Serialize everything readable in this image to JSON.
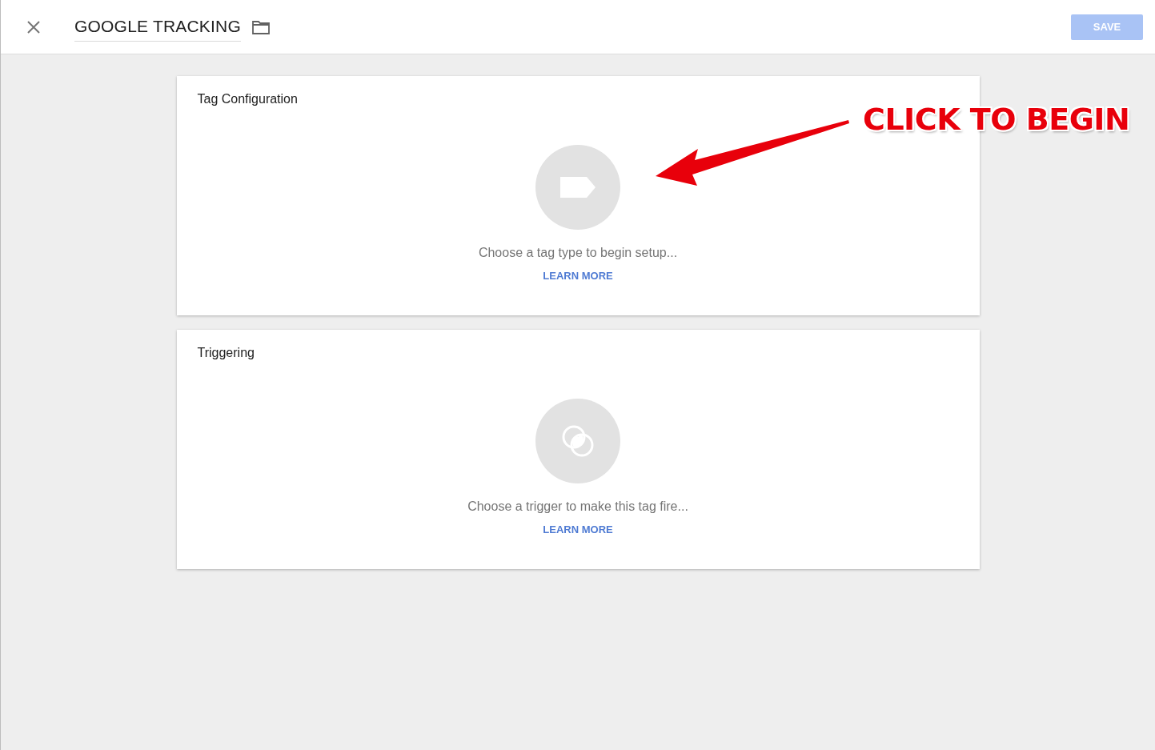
{
  "header": {
    "title": "GOOGLE TRACKING",
    "save_button": "SAVE"
  },
  "cards": [
    {
      "kind": "tag",
      "title": "Tag Configuration",
      "prompt": "Choose a tag type to begin setup...",
      "link": "LEARN MORE"
    },
    {
      "kind": "trigger",
      "title": "Triggering",
      "prompt": "Choose a trigger to make this tag fire...",
      "link": "LEARN MORE"
    }
  ],
  "annotation": {
    "text": "CLICK TO BEGIN"
  }
}
